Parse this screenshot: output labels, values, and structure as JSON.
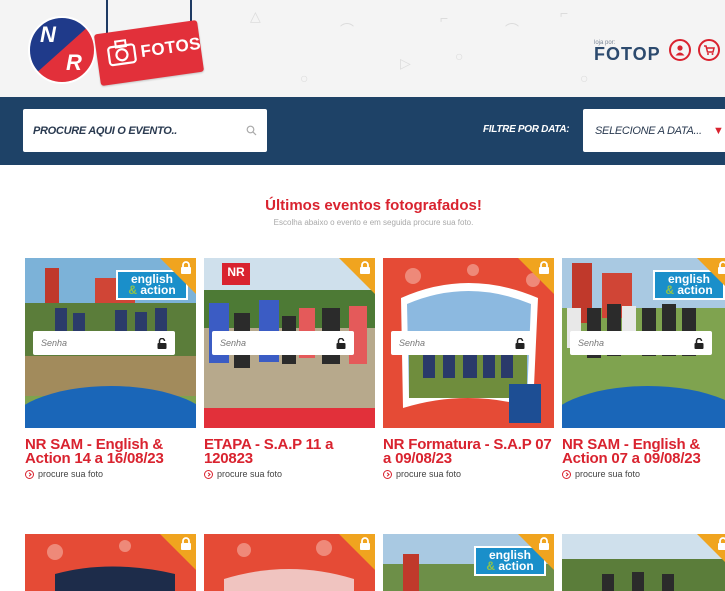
{
  "header": {
    "logo_letters": [
      "N",
      "R"
    ],
    "sign_text": "FOTOS",
    "powered_small": "loja por:",
    "powered_brand": "FOTOP",
    "user_icon": "user-icon",
    "cart_icon": "cart-icon"
  },
  "search_bar": {
    "placeholder": "PROCURE AQUI O EVENTO..",
    "filter_label": "FILTRE POR DATA:",
    "select_value": "SELECIONE A DATA..."
  },
  "section": {
    "title": "Últimos eventos fotografados!",
    "subtitle": "Escolha abaixo o evento e em seguida procure sua foto."
  },
  "events": [
    {
      "title": "NR SAM - English & Action 14 a 16/08/23",
      "link": "procure sua foto",
      "password_placeholder": "Senha",
      "tag": "english action"
    },
    {
      "title": "ETAPA - S.A.P 11 a 120823",
      "link": "procure sua foto",
      "password_placeholder": "Senha",
      "badge": "NR"
    },
    {
      "title": "NR Formatura - S.A.P 07 a 09/08/23",
      "link": "procure sua foto",
      "password_placeholder": "Senha"
    },
    {
      "title": "NR SAM - English & Action 07 a 09/08/23",
      "link": "procure sua foto",
      "password_placeholder": "Senha",
      "tag": "english action"
    }
  ],
  "colors": {
    "brand_red": "#d9232f",
    "nav_blue": "#1e4267",
    "accent_orange": "#f0a41f"
  }
}
